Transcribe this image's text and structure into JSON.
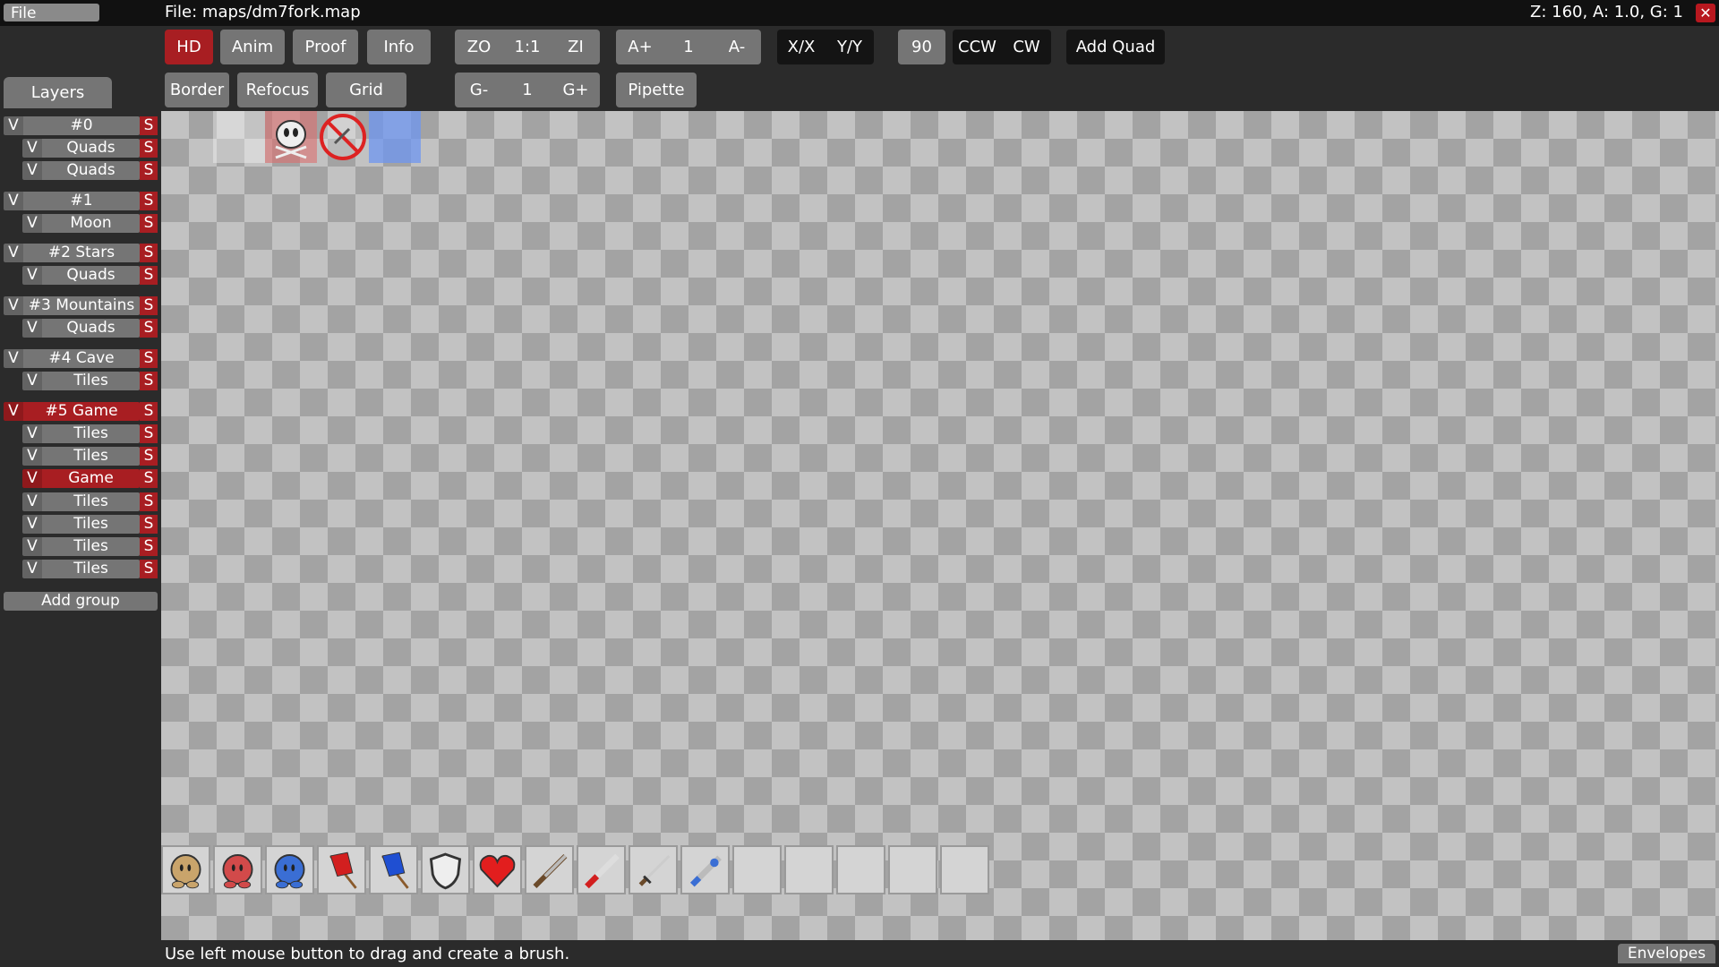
{
  "topbar": {
    "file_menu": "File",
    "file_name": "File: maps/dm7fork.map",
    "status": "Z: 160, A: 1.0, G: 1",
    "close": "✕"
  },
  "toolbar": {
    "row1": {
      "hd": "HD",
      "anim": "Anim",
      "proof": "Proof",
      "info": "Info",
      "zoom_out": "ZO",
      "zoom_reset": "1:1",
      "zoom_in": "ZI",
      "anim_plus": "A+",
      "anim_value": "1",
      "anim_minus": "A-",
      "flip_x": "X/X",
      "flip_y": "Y/Y",
      "rotate_value": "90",
      "ccw": "CCW",
      "cw": "CW",
      "add_quad": "Add Quad"
    },
    "row2": {
      "border": "Border",
      "refocus": "Refocus",
      "grid": "Grid",
      "grid_minus": "G-",
      "grid_value": "1",
      "grid_plus": "G+",
      "pipette": "Pipette"
    }
  },
  "layers": {
    "tab_label": "Layers",
    "rows": [
      {
        "v": "V",
        "name": "#0",
        "s": "S",
        "group": true,
        "sel": false
      },
      {
        "v": "V",
        "name": "Quads",
        "s": "S",
        "group": false,
        "sel": false
      },
      {
        "v": "V",
        "name": "Quads",
        "s": "S",
        "group": false,
        "sel": false
      },
      {
        "v": "V",
        "name": "#1",
        "s": "S",
        "group": true,
        "sel": false
      },
      {
        "v": "V",
        "name": "Moon",
        "s": "S",
        "group": false,
        "sel": false
      },
      {
        "v": "V",
        "name": "#2 Stars",
        "s": "S",
        "group": true,
        "sel": false
      },
      {
        "v": "V",
        "name": "Quads",
        "s": "S",
        "group": false,
        "sel": false
      },
      {
        "v": "V",
        "name": "#3 Mountains",
        "s": "S",
        "group": true,
        "sel": false
      },
      {
        "v": "V",
        "name": "Quads",
        "s": "S",
        "group": false,
        "sel": false
      },
      {
        "v": "V",
        "name": "#4 Cave",
        "s": "S",
        "group": true,
        "sel": false
      },
      {
        "v": "V",
        "name": "Tiles",
        "s": "S",
        "group": false,
        "sel": false
      },
      {
        "v": "V",
        "name": "#5 Game",
        "s": "S",
        "group": true,
        "sel": true
      },
      {
        "v": "V",
        "name": "Tiles",
        "s": "S",
        "group": false,
        "sel": false
      },
      {
        "v": "V",
        "name": "Tiles",
        "s": "S",
        "group": false,
        "sel": false
      },
      {
        "v": "V",
        "name": "Game",
        "s": "S",
        "group": false,
        "sel": true
      },
      {
        "v": "V",
        "name": "Tiles",
        "s": "S",
        "group": false,
        "sel": false
      },
      {
        "v": "V",
        "name": "Tiles",
        "s": "S",
        "group": false,
        "sel": false
      },
      {
        "v": "V",
        "name": "Tiles",
        "s": "S",
        "group": false,
        "sel": false
      },
      {
        "v": "V",
        "name": "Tiles",
        "s": "S",
        "group": false,
        "sel": false
      }
    ],
    "add_group": "Add group"
  },
  "entities": [
    "tee-spawn-icon",
    "red-spawn-icon",
    "blue-spawn-icon",
    "red-flag-icon",
    "blue-flag-icon",
    "armor-icon",
    "health-icon",
    "shotgun-icon",
    "grenade-icon",
    "katana-icon",
    "laser-icon",
    "empty",
    "empty",
    "empty",
    "empty",
    "empty"
  ],
  "statusbar": {
    "hint": "Use left mouse button to drag and create a brush.",
    "envelopes": "Envelopes"
  },
  "colors": {
    "accent_red": "#a81e22",
    "button_gray": "#757575",
    "topbar": "#111111"
  }
}
